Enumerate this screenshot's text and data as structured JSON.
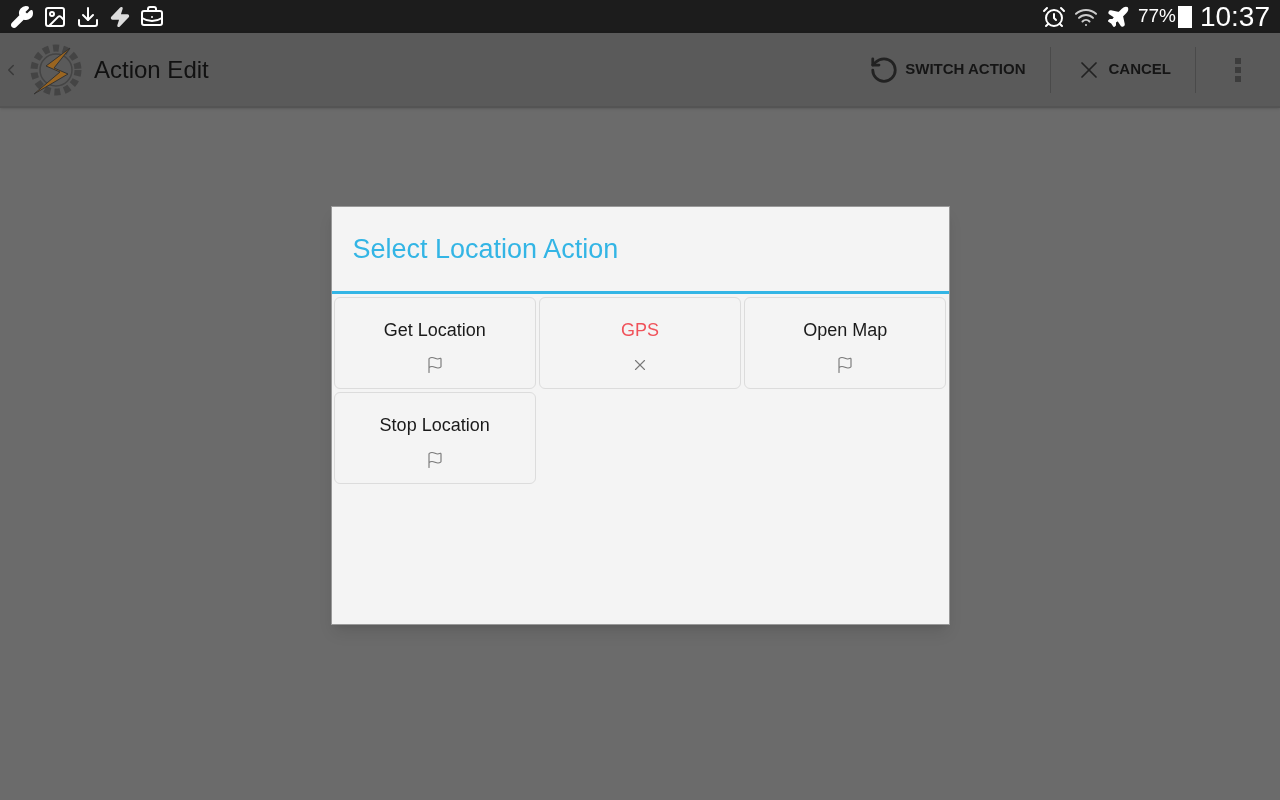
{
  "status_bar": {
    "battery": "77%",
    "time": "10:37"
  },
  "action_bar": {
    "title": "Action Edit",
    "actions": [
      "SWITCH ACTION",
      "CANCEL"
    ]
  },
  "dialog": {
    "title": "Select Location Action",
    "items": [
      {
        "label": "Get Location",
        "kind": "flag"
      },
      {
        "label": "GPS",
        "kind": "unavailable"
      },
      {
        "label": "Open Map",
        "kind": "flag"
      },
      {
        "label": "Stop Location",
        "kind": "flag"
      }
    ]
  }
}
